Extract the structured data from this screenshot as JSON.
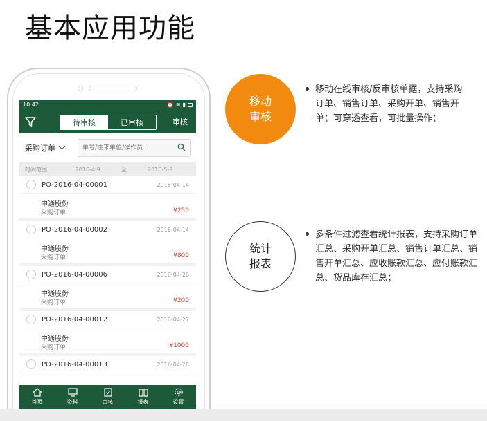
{
  "page_title": "基本应用功能",
  "phone": {
    "status": {
      "time": "10:42"
    },
    "appbar": {
      "tab_pending": "待审核",
      "tab_done": "已审核",
      "action": "审核"
    },
    "search": {
      "type_label": "采购订单",
      "placeholder": "单号/往来单位/操作员..."
    },
    "date_range": {
      "label": "时间范围:",
      "from": "2016-4-9",
      "to_word": "至",
      "to": "2016-5-9"
    },
    "orders": [
      {
        "no": "PO-2016-04-00001",
        "date": "2016-04-14",
        "customer": "中通股份",
        "type": "采购订单",
        "amount": "¥250"
      },
      {
        "no": "PO-2016-04-00002",
        "date": "2016-04-14",
        "customer": "中通股份",
        "type": "采购订单",
        "amount": "¥800"
      },
      {
        "no": "PO-2016-04-00006",
        "date": "2016-04-26",
        "customer": "中通股份",
        "type": "采购订单",
        "amount": "¥200"
      },
      {
        "no": "PO-2016-04-00012",
        "date": "2016-04-27",
        "customer": "中通股份",
        "type": "采购订单",
        "amount": "¥1000"
      },
      {
        "no": "PO-2016-04-00013",
        "date": "2016-04-28",
        "customer": "",
        "type": "",
        "amount": ""
      }
    ],
    "tabs": [
      "首页",
      "资料",
      "审核",
      "报表",
      "设置"
    ]
  },
  "features": [
    {
      "circle_line1": "移动",
      "circle_line2": "审核",
      "text": "移动在线审核/反审核单据，支持采购订单、销售订单、采购开单、销售开单；可穿透查看，可批量操作；"
    },
    {
      "circle_line1": "统计",
      "circle_line2": "报表",
      "text": "多条件过滤查看统计报表，支持采购订单汇总、采购开单汇总、销售订单汇总、销售开单汇总、应收账款汇总、应付账款汇总、货品库存汇总；"
    }
  ],
  "colors": {
    "primary_green": "#1c5a3a",
    "accent_orange": "#f28a10",
    "amount_red": "#d4502c"
  }
}
